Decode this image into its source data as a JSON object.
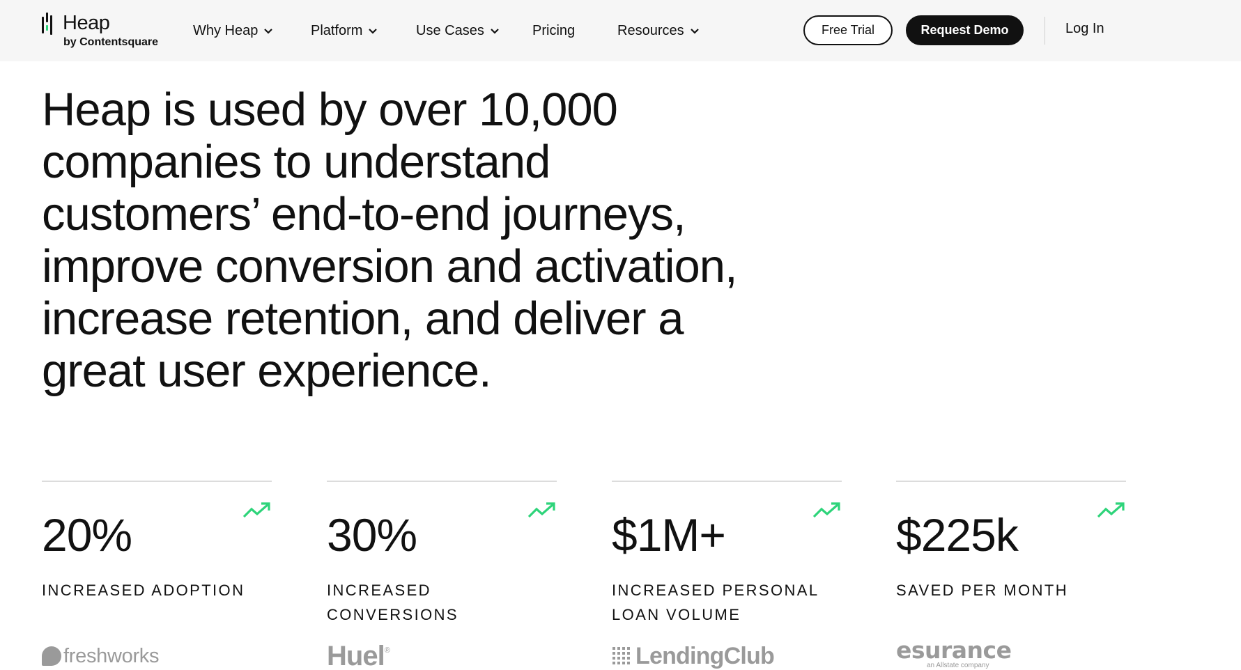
{
  "brand": {
    "name": "Heap",
    "tagline": "by Contentsquare",
    "accent_color": "#2ed47a"
  },
  "nav": {
    "items": [
      {
        "label": "Why Heap",
        "has_dropdown": true
      },
      {
        "label": "Platform",
        "has_dropdown": true
      },
      {
        "label": "Use Cases",
        "has_dropdown": true
      },
      {
        "label": "Pricing",
        "has_dropdown": false
      },
      {
        "label": "Resources",
        "has_dropdown": true
      }
    ],
    "free_trial_label": "Free Trial",
    "request_demo_label": "Request Demo",
    "login_label": "Log In"
  },
  "hero": {
    "headline": "Heap is used by over 10,000 companies to understand customers’ end-to-end journeys, improve conversion and activation, increase retention, and deliver a great user experience."
  },
  "stats": [
    {
      "value": "20%",
      "label": "Increased adoption",
      "icon": "trend-up-icon",
      "customer": "freshworks"
    },
    {
      "value": "30%",
      "label": "Increased conversions",
      "icon": "trend-up-icon",
      "customer": "Huel"
    },
    {
      "value": "$1M+",
      "label": "Increased personal loan volume",
      "icon": "trend-up-icon",
      "customer": "LendingClub"
    },
    {
      "value": "$225k",
      "label": "Saved per month",
      "icon": "trend-up-icon",
      "customer": "esurance",
      "customer_sub": "an Allstate company"
    }
  ],
  "colors": {
    "header_bg": "#f6f6f6",
    "text": "#111111",
    "logo_gray": "#9a9a9a",
    "trend_green": "#2ed47a"
  }
}
